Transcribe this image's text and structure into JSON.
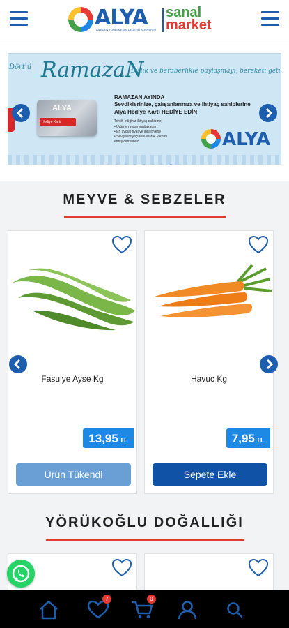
{
  "header": {
    "brand_name": "ALYA",
    "brand_tagline": "AİLEDEN YÖNELMENİN DEĞERLİ ALIŞVERİŞİ",
    "brand_sanal": "sanal",
    "brand_market": "market",
    "menu_icon": "hamburger-icon"
  },
  "banner": {
    "script_left": "Dört'ü",
    "title": "RamazaN",
    "slogan": "Birlik ve beraberlikle paylaşmayı, bereketi getirdin",
    "heading": "RAMAZAN AYINDA",
    "line1": "Sevdiklerinize, çalışanlarınıza ve ihtiyaç sahiplerine",
    "line2": "Alya Hediye Kartı HEDİYE EDİN",
    "small1": "Tercih ettiğiniz ihtiyaç sahibine;",
    "small2": "• Ürün en yakın mağazadan",
    "small3": "• En uygun fiyat ve indirimlerle",
    "small4": "• Sevgili ihtiyaçlarını alarak yardım",
    "small5": "  etmiş olursunuz.",
    "card_brand": "ALYA",
    "card_label": "Hediye Kartı",
    "logo_text": "ALYA",
    "dots_count": 9,
    "active_dot": 7
  },
  "sections": [
    {
      "title": "MEYVE & SEBZELER"
    },
    {
      "title": "YÖRÜKOĞLU DOĞALLIĞI"
    }
  ],
  "products": [
    {
      "name": "Fasulye Ayse Kg",
      "price": "13,95",
      "currency": "TL",
      "button": "Ürün Tükendi",
      "available": false
    },
    {
      "name": "Havuc Kg",
      "price": "7,95",
      "currency": "TL",
      "button": "Sepete Ekle",
      "available": true
    }
  ],
  "bottom_nav": {
    "items": [
      {
        "icon": "home-icon"
      },
      {
        "icon": "heart-icon",
        "badge": "7"
      },
      {
        "icon": "cart-icon",
        "badge": "0"
      },
      {
        "icon": "user-icon"
      },
      {
        "icon": "search-icon"
      }
    ]
  },
  "colors": {
    "brand_blue": "#1d5fae",
    "accent_red": "#e23b2f",
    "price_blue": "#1e88e5",
    "whatsapp_green": "#25d366"
  }
}
